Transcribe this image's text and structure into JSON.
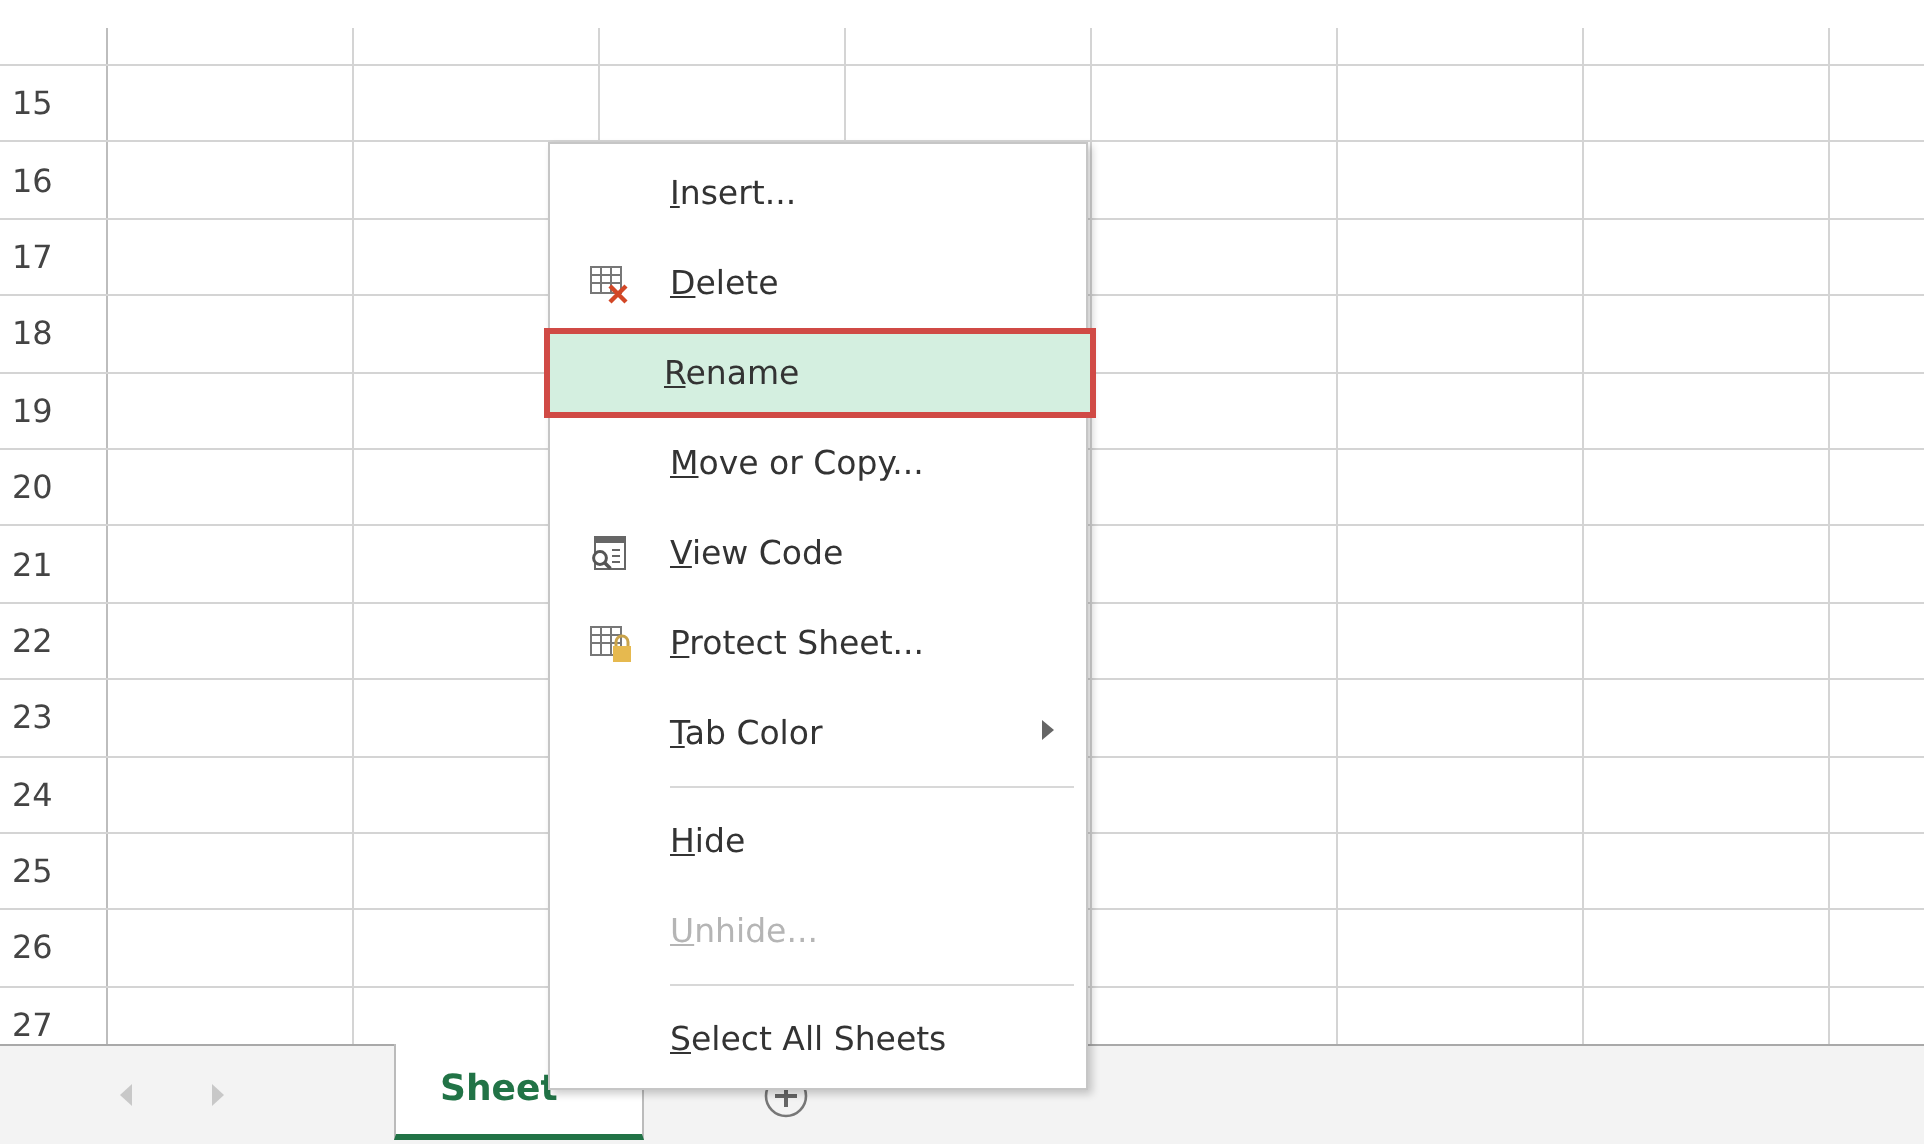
{
  "sheet": {
    "row_headers": [
      "15",
      "16",
      "17",
      "18",
      "19",
      "20",
      "21",
      "22",
      "23",
      "24",
      "25",
      "26",
      "27"
    ]
  },
  "context_menu": {
    "items": [
      {
        "kind": "item",
        "label": "Insert...",
        "highlighted": false,
        "disabled": false,
        "submenu": false
      },
      {
        "kind": "item",
        "label": "Delete",
        "highlighted": false,
        "disabled": false,
        "submenu": false
      },
      {
        "kind": "item",
        "label": "Rename",
        "highlighted": true,
        "disabled": false,
        "submenu": false
      },
      {
        "kind": "item",
        "label": "Move or Copy...",
        "highlighted": false,
        "disabled": false,
        "submenu": false
      },
      {
        "kind": "item",
        "label": "View Code",
        "highlighted": false,
        "disabled": false,
        "submenu": false
      },
      {
        "kind": "item",
        "label": "Protect Sheet...",
        "highlighted": false,
        "disabled": false,
        "submenu": false
      },
      {
        "kind": "item",
        "label": "Tab Color",
        "highlighted": false,
        "disabled": false,
        "submenu": true
      },
      {
        "kind": "separator"
      },
      {
        "kind": "item",
        "label": "Hide",
        "highlighted": false,
        "disabled": false,
        "submenu": false
      },
      {
        "kind": "item",
        "label": "Unhide...",
        "highlighted": false,
        "disabled": true,
        "submenu": false
      },
      {
        "kind": "separator"
      },
      {
        "kind": "item",
        "label": "Select All Sheets",
        "highlighted": false,
        "disabled": false,
        "submenu": false
      }
    ]
  },
  "sheet_tabs": [
    {
      "label": "Sheet",
      "selected": true
    }
  ]
}
